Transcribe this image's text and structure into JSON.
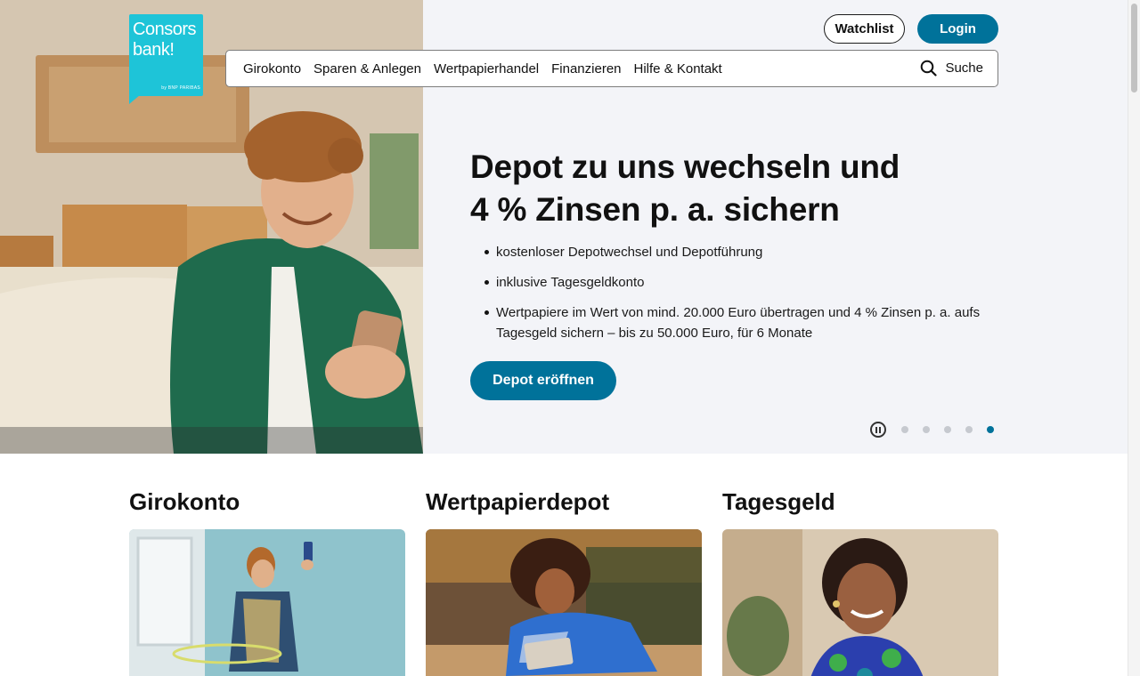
{
  "brand": {
    "line1": "Consors",
    "line2": "bank!",
    "tagline": "by BNP PARIBAS",
    "color": "#1ec4d8"
  },
  "header": {
    "watchlist_label": "Watchlist",
    "login_label": "Login"
  },
  "nav": {
    "items": [
      {
        "label": "Girokonto"
      },
      {
        "label": "Sparen & Anlegen"
      },
      {
        "label": "Wertpapierhandel"
      },
      {
        "label": "Finanzieren"
      },
      {
        "label": "Hilfe & Kontakt"
      }
    ],
    "search_label": "Suche",
    "search_icon": "search-icon"
  },
  "hero": {
    "title_line1": "Depot zu uns wechseln und",
    "title_line2": "4 % Zinsen p. a. sichern",
    "bullets": [
      "kostenloser Depotwechsel und Depotführung",
      "inklusive Tagesgeldkonto",
      "Wertpapiere im Wert von mind. 20.000 Euro übertragen und 4 % Zinsen p. a. aufs Tagesgeld sichern – bis zu 50.000 Euro, für 6 Monate"
    ],
    "cta_label": "Depot eröffnen"
  },
  "carousel": {
    "slide_count": 5,
    "active_slide": 5,
    "pause_icon": "pause-icon"
  },
  "cards": [
    {
      "title": "Girokonto"
    },
    {
      "title": "Wertpapierdepot"
    },
    {
      "title": "Tagesgeld"
    }
  ],
  "colors": {
    "primary": "#00729a",
    "hero_bg": "#f3f4f8",
    "dot_inactive": "#c6c9cf"
  }
}
